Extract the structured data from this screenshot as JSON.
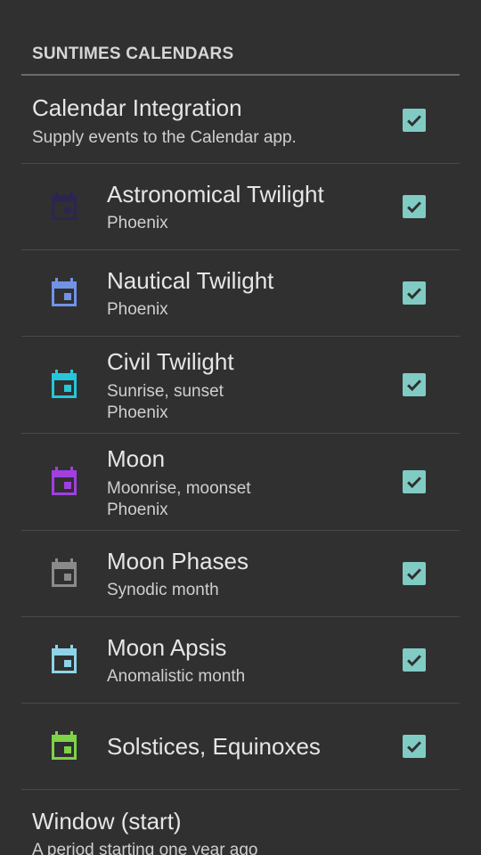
{
  "section": {
    "header": "SUNTIMES CALENDARS"
  },
  "integration": {
    "title": "Calendar Integration",
    "summary": "Supply events to the Calendar app.",
    "checked": true
  },
  "calendars": [
    {
      "title": "Astronomical Twilight",
      "summary": [
        "Phoenix"
      ],
      "color": "#2a2650",
      "checked": true
    },
    {
      "title": "Nautical Twilight",
      "summary": [
        "Phoenix"
      ],
      "color": "#7193e6",
      "checked": true
    },
    {
      "title": "Civil Twilight",
      "summary": [
        "Sunrise, sunset",
        "Phoenix"
      ],
      "color": "#26c6da",
      "checked": true
    },
    {
      "title": "Moon",
      "summary": [
        "Moonrise, moonset",
        "Phoenix"
      ],
      "color": "#a040e0",
      "checked": true
    },
    {
      "title": "Moon Phases",
      "summary": [
        "Synodic month"
      ],
      "color": "#8a8a8a",
      "checked": true
    },
    {
      "title": "Moon Apsis",
      "summary": [
        "Anomalistic month"
      ],
      "color": "#8fd3e8",
      "checked": true
    },
    {
      "title": "Solstices, Equinoxes",
      "summary": [],
      "color": "#7ed348",
      "checked": true
    }
  ],
  "window_start": {
    "title": "Window (start)",
    "summary": "A period starting one year ago"
  },
  "colors": {
    "background": "#303030",
    "checkbox": "#80cbc4",
    "divider": "#4a4a4a"
  },
  "icons": {
    "calendar": "calendar-event-icon",
    "check": "check-icon"
  }
}
